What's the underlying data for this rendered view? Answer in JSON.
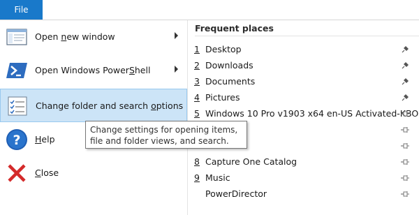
{
  "ribbon": {
    "file_tab": "File",
    "accent": "#1979ca"
  },
  "menu": {
    "items": [
      {
        "pre": "Open ",
        "accel": "n",
        "post": "ew window",
        "has_arrow": true,
        "icon": "new-window-icon"
      },
      {
        "pre": "Open Windows Power",
        "accel": "S",
        "post": "hell",
        "has_arrow": true,
        "icon": "powershell-icon"
      },
      {
        "pre": "Change folder and search ",
        "accel": "o",
        "post": "ptions",
        "has_arrow": false,
        "icon": "options-icon"
      },
      {
        "pre": "",
        "accel": "H",
        "post": "elp",
        "has_arrow": false,
        "icon": "help-icon"
      },
      {
        "pre": "",
        "accel": "C",
        "post": "lose",
        "has_arrow": false,
        "icon": "close-icon"
      }
    ]
  },
  "frequent_places": {
    "heading": "Frequent places",
    "items": [
      {
        "num": "1",
        "name": "Desktop",
        "pin": "pinned"
      },
      {
        "num": "2",
        "name": "Downloads",
        "pin": "pinned"
      },
      {
        "num": "3",
        "name": "Documents",
        "pin": "pinned"
      },
      {
        "num": "4",
        "name": "Pictures",
        "pin": "pinned"
      },
      {
        "num": "5",
        "name": "Windows 10 Pro v1903 x64 en-US Activated-KBO",
        "pin": "unpinned"
      },
      {
        "num": "",
        "name": "",
        "pin": "unpinned"
      },
      {
        "num": "",
        "name": "",
        "pin": "unpinned"
      },
      {
        "num": "8",
        "name": "Capture One Catalog",
        "pin": "unpinned"
      },
      {
        "num": "9",
        "name": "Music",
        "pin": "unpinned"
      },
      {
        "num": "",
        "name": "PowerDirector",
        "pin": "unpinned"
      }
    ]
  },
  "tooltip": {
    "line1": "Change settings for opening items,",
    "line2": "file and folder views, and search."
  }
}
